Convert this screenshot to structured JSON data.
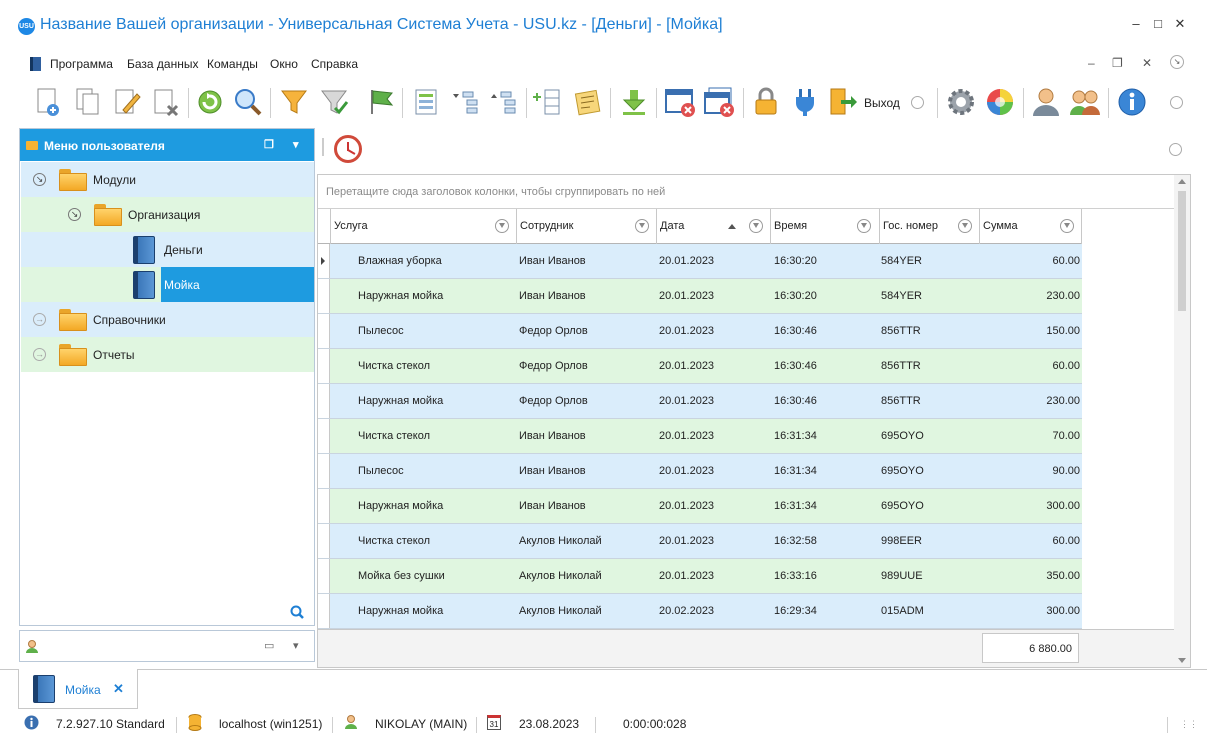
{
  "window": {
    "title": "Название Вашей организации - Универсальная Система Учета - USU.kz - [Деньги] - [Мойка]",
    "logo_text": "USU"
  },
  "menu": {
    "items": [
      "Программа",
      "База данных",
      "Команды",
      "Окно",
      "Справка"
    ]
  },
  "toolbar": {
    "exit_label": "Выход"
  },
  "sidebar": {
    "title": "Меню пользователя",
    "tree": [
      {
        "label": "Модули"
      },
      {
        "label": "Организация"
      },
      {
        "label": "Деньги"
      },
      {
        "label": "Мойка"
      },
      {
        "label": "Справочники"
      },
      {
        "label": "Отчеты"
      }
    ]
  },
  "grid": {
    "group_hint": "Перетащите сюда заголовок колонки, чтобы сгруппировать по ней",
    "columns": [
      "Услуга",
      "Сотрудник",
      "Дата",
      "Время",
      "Гос. номер",
      "Сумма"
    ],
    "rows": [
      [
        "Влажная уборка",
        "Иван Иванов",
        "20.01.2023",
        "16:30:20",
        "584YER",
        "60.00"
      ],
      [
        "Наружная мойка",
        "Иван Иванов",
        "20.01.2023",
        "16:30:20",
        "584YER",
        "230.00"
      ],
      [
        "Пылесос",
        "Федор Орлов",
        "20.01.2023",
        "16:30:46",
        "856TTR",
        "150.00"
      ],
      [
        "Чистка стекол",
        "Федор Орлов",
        "20.01.2023",
        "16:30:46",
        "856TTR",
        "60.00"
      ],
      [
        "Наружная мойка",
        "Федор Орлов",
        "20.01.2023",
        "16:30:46",
        "856TTR",
        "230.00"
      ],
      [
        "Чистка стекол",
        "Иван Иванов",
        "20.01.2023",
        "16:31:34",
        "695OYO",
        "70.00"
      ],
      [
        "Пылесос",
        "Иван Иванов",
        "20.01.2023",
        "16:31:34",
        "695OYO",
        "90.00"
      ],
      [
        "Наружная мойка",
        "Иван Иванов",
        "20.01.2023",
        "16:31:34",
        "695OYO",
        "300.00"
      ],
      [
        "Чистка стекол",
        "Акулов Николай",
        "20.01.2023",
        "16:32:58",
        "998EER",
        "60.00"
      ],
      [
        "Мойка без сушки",
        "Акулов Николай",
        "20.01.2023",
        "16:33:16",
        "989UUE",
        "350.00"
      ],
      [
        "Наружная мойка",
        "Акулов Николай",
        "20.02.2023",
        "16:29:34",
        "015ADM",
        "300.00"
      ]
    ],
    "total": "6 880.00"
  },
  "tabs": {
    "active_tab": "Мойка",
    "close_glyph": "✕"
  },
  "status": {
    "version": "7.2.927.10 Standard",
    "server": "localhost (win1251)",
    "user": "NIKOLAY (MAIN)",
    "calendar_day": "31",
    "date": "23.08.2023",
    "timer": "0:00:00:028"
  }
}
